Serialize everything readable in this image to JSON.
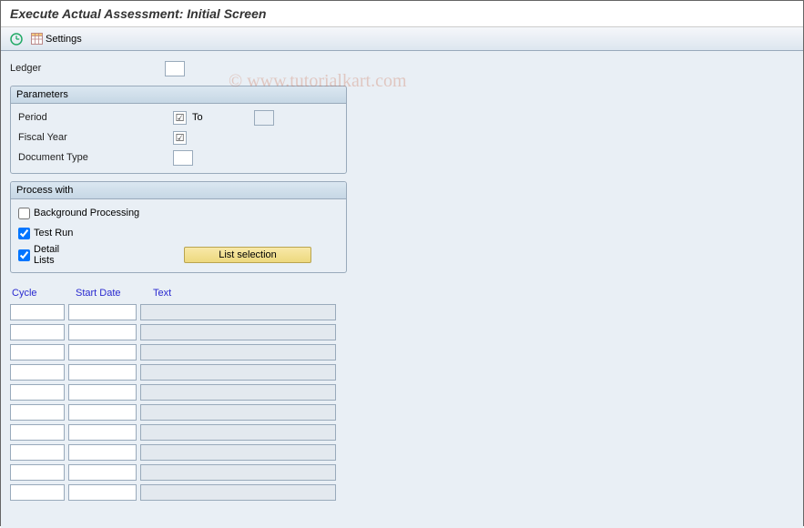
{
  "title": "Execute Actual Assessment: Initial Screen",
  "toolbar": {
    "settings_label": "Settings"
  },
  "ledger": {
    "label": "Ledger",
    "value": ""
  },
  "parameters": {
    "legend": "Parameters",
    "period_label": "Period",
    "period_value": "",
    "to_label": "To",
    "to_value": "",
    "fiscal_year_label": "Fiscal Year",
    "fiscal_year_value": "",
    "doc_type_label": "Document Type",
    "doc_type_value": ""
  },
  "process": {
    "legend": "Process with",
    "bg_label": "Background Processing",
    "bg_checked": false,
    "test_label": "Test Run",
    "test_checked": true,
    "detail_label": "Detail Lists",
    "detail_checked": true,
    "list_selection_label": "List selection"
  },
  "table": {
    "headers": {
      "cycle": "Cycle",
      "start": "Start Date",
      "text": "Text"
    },
    "row_count": 10
  },
  "watermark": "© www.tutorialkart.com"
}
